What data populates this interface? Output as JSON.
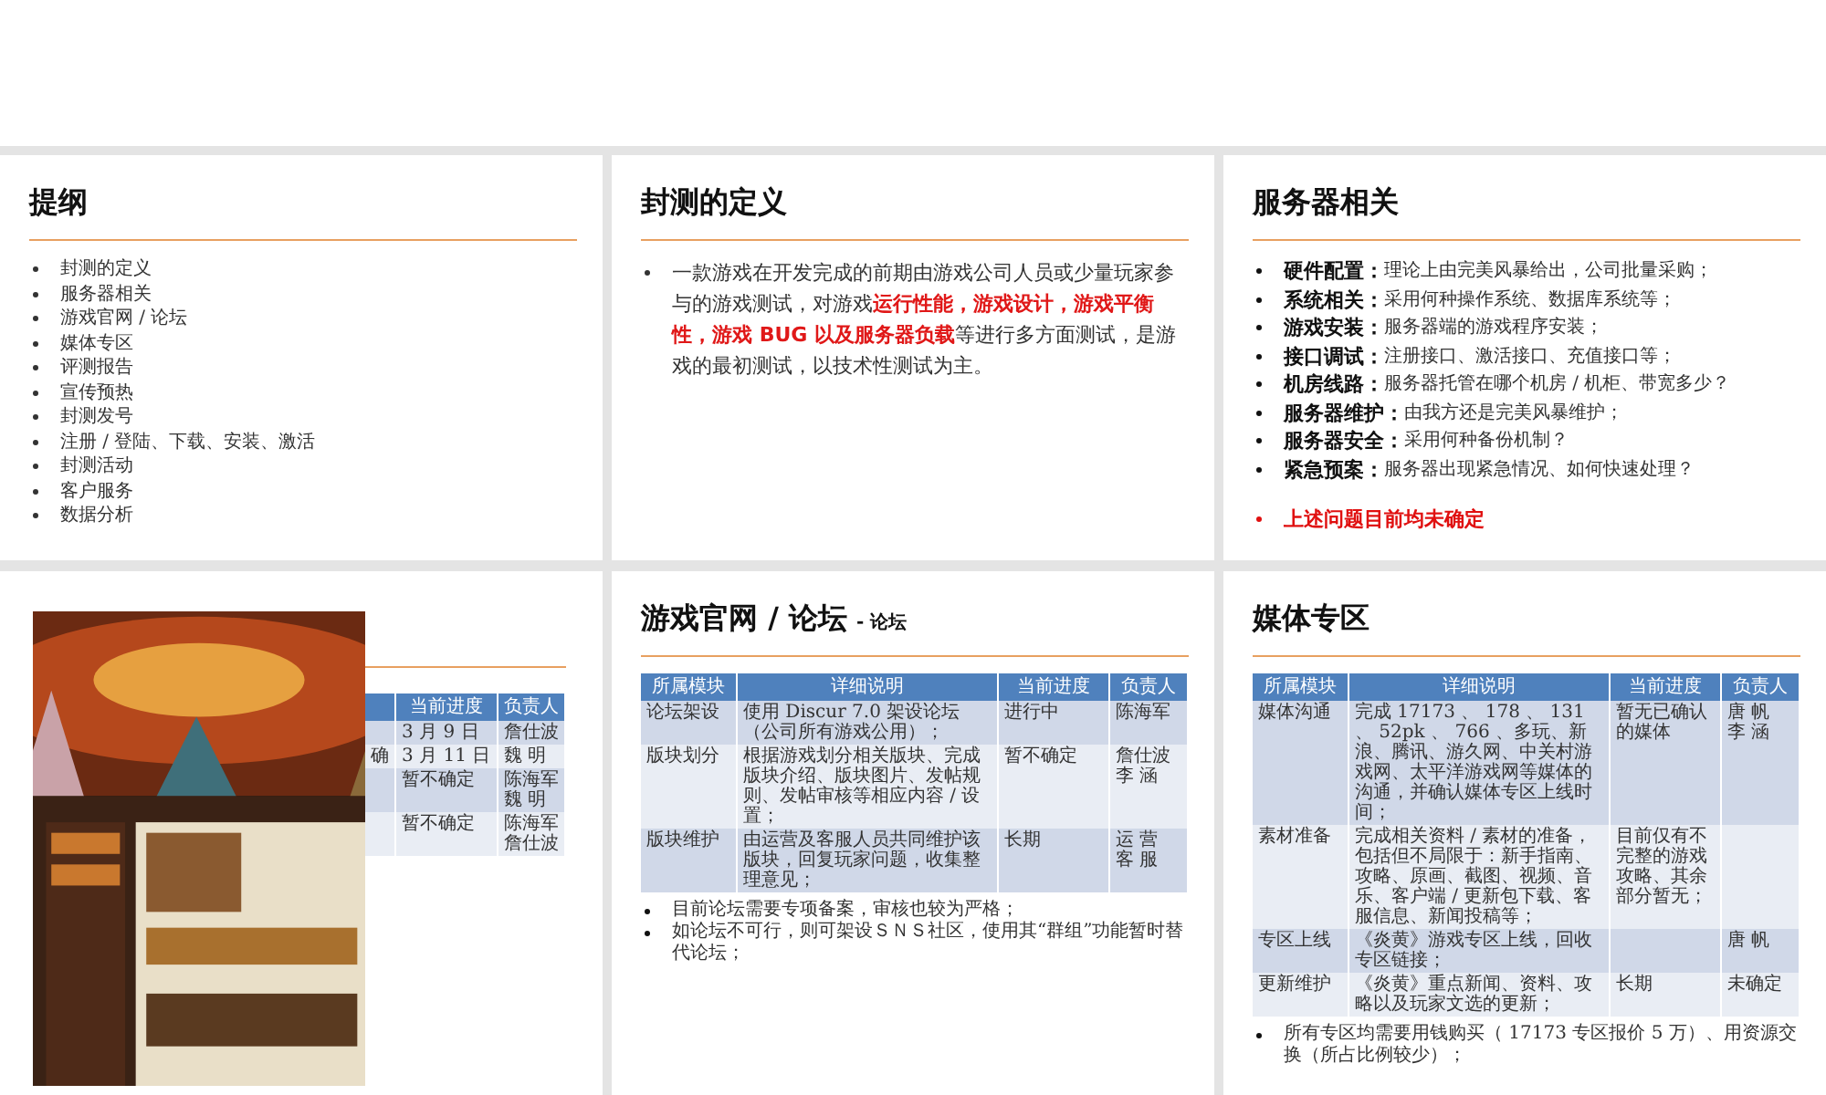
{
  "slides": [
    {
      "kind": "list",
      "title": "提纲",
      "items": [
        "封测的定义",
        "服务器相关",
        "游戏官网 / 论坛",
        "媒体专区",
        "评测报告",
        "宣传预热",
        "封测发号",
        "注册 / 登陆、下载、安装、激活",
        "封测活动",
        "客户服务",
        "数据分析"
      ]
    },
    {
      "kind": "paragraph",
      "title": "封测的定义",
      "paragraphs": [
        "一款游戏在开发完成的前期由游戏公司人员或少量玩家参与的游戏测试，对游戏**运行性能，游戏设计，游戏平衡性，游戏 BUG 以及服务器负载**等进行多方面测试，是游戏的最初测试，以技术性测试为主。"
      ]
    },
    {
      "kind": "labeled",
      "title": "服务器相关",
      "items": [
        {
          "label": "硬件配置：",
          "text": "理论上由完美风暴给出，公司批量采购；"
        },
        {
          "label": "系统相关：",
          "text": "采用何种操作系统、数据库系统等；"
        },
        {
          "label": "游戏安装：",
          "text": "服务器端的游戏程序安装；"
        },
        {
          "label": "接口调试：",
          "text": "注册接口、激活接口、充值接口等；"
        },
        {
          "label": "机房线路：",
          "text": "服务器托管在哪个机房 / 机柜、带宽多少？"
        },
        {
          "label": "服务器维护：",
          "text": "由我方还是完美风暴维护；"
        },
        {
          "label": "服务器安全：",
          "text": "采用何种备份机制？"
        },
        {
          "label": "紧急预案：",
          "text": "服务器出现紧急情况、如何快速处理？"
        }
      ],
      "note": "上述问题目前均未确定"
    },
    {
      "kind": "picture_table",
      "table": {
        "columns": [
          "当前进度",
          "负责人"
        ],
        "rows": [
          {
            "cut_text": "",
            "progress": "3 月 9 日",
            "owners": [
              "詹仕波"
            ]
          },
          {
            "cut_text": "确",
            "progress": "3 月 11 日",
            "owners": [
              "魏  明"
            ]
          },
          {
            "cut_text": "",
            "progress": "暂不确定",
            "owners": [
              "陈海军",
              "魏  明"
            ]
          },
          {
            "cut_text": "",
            "progress": "暂不确定",
            "owners": [
              "陈海军",
              "詹仕波"
            ]
          }
        ]
      }
    },
    {
      "kind": "table",
      "title": "游戏官网 / 论坛",
      "subtitle": "- 论坛",
      "table": {
        "columns": [
          "所属模块",
          "详细说明",
          "当前进度",
          "负责人"
        ],
        "rows": [
          {
            "module": "论坛架设",
            "detail": "使用 Discur 7.0 架设论坛（公司所有游戏公用）；",
            "progress": "进行中",
            "owners": [
              "陈海军"
            ]
          },
          {
            "module": "版块划分",
            "detail": "根据游戏划分相关版块、完成版块介绍、版块图片、发帖规则、发帖审核等相应内容 / 设置；",
            "progress": "暂不确定",
            "owners": [
              "詹仕波",
              "李  涵"
            ]
          },
          {
            "module": "版块维护",
            "detail": "由运营及客服人员共同维护该版块，回复玩家问题，收集整理意见；",
            "progress": "长期",
            "owners": [
              "运  营",
              "客  服"
            ]
          }
        ]
      },
      "notes": [
        "目前论坛需要专项备案，审核也较为严格；",
        "如论坛不可行，则可架设ＳＮＳ社区，使用其“群组”功能暂时替代论坛；"
      ]
    },
    {
      "kind": "table",
      "title": "媒体专区",
      "table": {
        "columns": [
          "所属模块",
          "详细说明",
          "当前进度",
          "负责人"
        ],
        "rows": [
          {
            "module": "媒体沟通",
            "detail": "完成 17173 、 178 、 131 、 52pk 、 766 、多玩、新浪、腾讯、游久网、中关村游戏网、太平洋游戏网等媒体的沟通，并确认媒体专区上线时间；",
            "progress": "暂无已确认的媒体",
            "owners": [
              "唐  帆",
              "李  涵"
            ]
          },
          {
            "module": "素材准备",
            "detail": "完成相关资料 / 素材的准备，包括但不局限于：新手指南、攻略、原画、截图、视频、音乐、客户端 / 更新包下载、客服信息、新闻投稿等；",
            "progress": "目前仅有不完整的游戏攻略、其余部分暂无；",
            "owners": []
          },
          {
            "module": "专区上线",
            "detail": "《炎黄》游戏专区上线，回收专区链接；",
            "progress": "",
            "owners": [
              "唐  帆"
            ]
          },
          {
            "module": "更新维护",
            "detail": "《炎黄》重点新闻、资料、攻略以及玩家文选的更新；",
            "progress": "长期",
            "owners": [
              "未确定"
            ]
          }
        ]
      },
      "notes": [
        "所有专区均需要用钱购买（ 17173 专区报价 5 万）、用资源交换（所占比例较少）；"
      ]
    }
  ]
}
